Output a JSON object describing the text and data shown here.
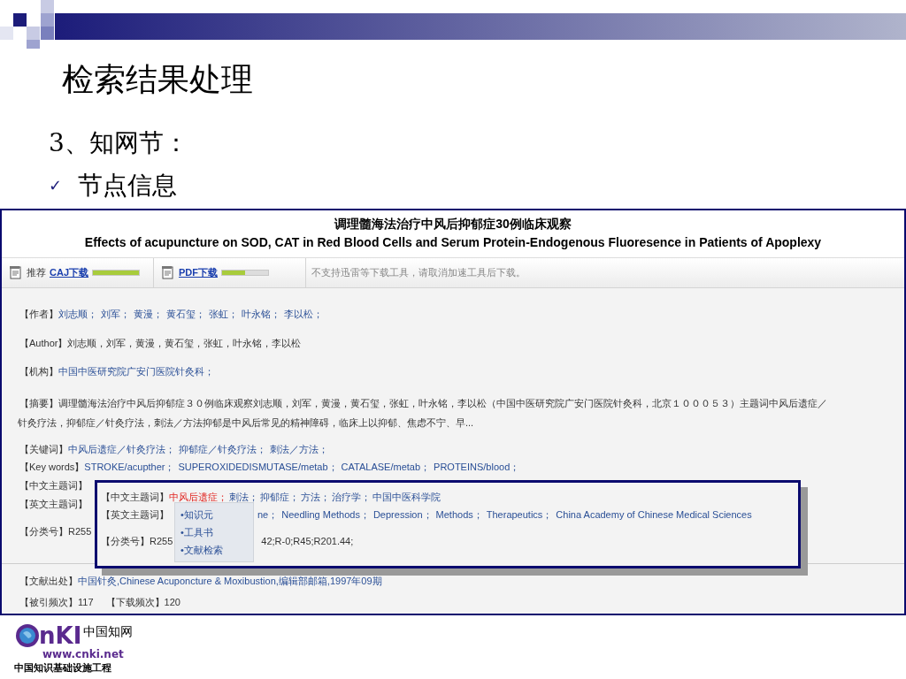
{
  "slide": {
    "title": "检索结果处理",
    "subtitle": "3、知网节：",
    "bullet": {
      "mark": "✓",
      "text": "节点信息"
    }
  },
  "page": {
    "title_cn": "调理髓海法治疗中风后抑郁症30例临床观察",
    "title_en": "Effects of acupuncture on SOD, CAT in Red Blood Cells and Serum Protein-Endogenous Fluoresence in Patients of Apoplexy",
    "toolbar": {
      "downloads": [
        {
          "prefix": "推荐",
          "link": "CAJ下载",
          "level": 1.0
        },
        {
          "link": "PDF下载",
          "level": 0.5
        }
      ],
      "notice": "不支持迅雷等下载工具，请取消加速工具后下载。"
    },
    "rows": [
      {
        "label": "【作者】",
        "kind": "links",
        "values": [
          "刘志顺；",
          "刘军；",
          "黄漫；",
          "黄石玺；",
          "张虹；",
          "叶永铭；",
          "李以松；"
        ]
      },
      {
        "label": "【Author】",
        "kind": "text",
        "values": [
          "刘志顺，刘军，黄漫，黄石玺，张虹，叶永铭，李以松"
        ]
      },
      {
        "label": "【机构】",
        "kind": "links",
        "values": [
          "中国中医研究院广安门医院针灸科；"
        ]
      },
      {
        "label": "【摘要】",
        "kind": "paragraph",
        "values": [
          "调理髓海法治疗中风后抑郁症３０例临床观察刘志顺，刘军，黄漫，黄石玺，张虹，叶永铭，李以松（中国中医研究院广安门医院针灸科，北京１０００５３）主题词中风后遗症／",
          "针灸疗法，抑郁症／针灸疗法，刺法／方法抑郁是中风后常见的精神障碍，临床上以抑郁、焦虑不宁、早..."
        ]
      },
      {
        "label": "【关键词】",
        "kind": "links",
        "values": [
          "中风后遗症／针灸疗法；",
          "抑郁症／针灸疗法；",
          "刺法／方法；"
        ]
      },
      {
        "label": "【Key words】",
        "kind": "links",
        "values": [
          "STROKE/acupther；",
          "SUPEROXIDEDISMUTASE/metab；",
          "CATALASE/metab；",
          "PROTEINS/blood；"
        ]
      },
      {
        "label": "【中文主题词】",
        "kind": "label"
      },
      {
        "label": "【英文主题词】",
        "kind": "label"
      },
      {
        "label": "【分类号】",
        "kind": "text",
        "values": [
          "R255"
        ]
      }
    ],
    "source": {
      "label": "【文献出处】",
      "values": [
        "中国针灸",
        " ,Chinese Acuponcture & Moxibustion",
        " ,编辑部邮箱",
        " ,1997年09期"
      ]
    },
    "counts": [
      {
        "label": "【被引频次】",
        "value": "117"
      },
      {
        "label": "【下载频次】",
        "value": "120"
      }
    ],
    "popup": {
      "rows": [
        {
          "label": "【中文主题词】",
          "items": [
            {
              "text": "中风后遗症",
              "selected": true
            },
            {
              "text": "刺法",
              "selected": false
            },
            {
              "text": "抑郁症",
              "selected": false
            },
            {
              "text": "方法",
              "selected": false
            },
            {
              "text": "治疗学",
              "selected": false
            },
            {
              "text": "中国中医科学院",
              "selected": false
            }
          ],
          "sep": "；"
        },
        {
          "label": "【英文主题词】",
          "items": [
            {
              "text": "ne",
              "selected": false
            },
            {
              "text": "Needling Methods",
              "selected": false
            },
            {
              "text": "Depression",
              "selected": false
            },
            {
              "text": "Methods",
              "selected": false
            },
            {
              "text": "Therapeutics",
              "selected": false
            },
            {
              "text": "China Academy of Chinese Medical Sciences",
              "selected": false
            }
          ],
          "sep": "；"
        },
        {
          "label": "【分类号】",
          "head": "R255",
          "tail": "42;R-0;R45;R201.44;"
        }
      ],
      "menu": [
        {
          "mark": "•",
          "text": "知识元"
        },
        {
          "mark": "•",
          "text": "工具书"
        },
        {
          "mark": "•",
          "text": "文献检索"
        }
      ]
    }
  },
  "logo": {
    "mark": "nKI",
    "cn": "中国知网",
    "url": "www.cnki.net",
    "tagline": "中国知识基础设施工程"
  }
}
